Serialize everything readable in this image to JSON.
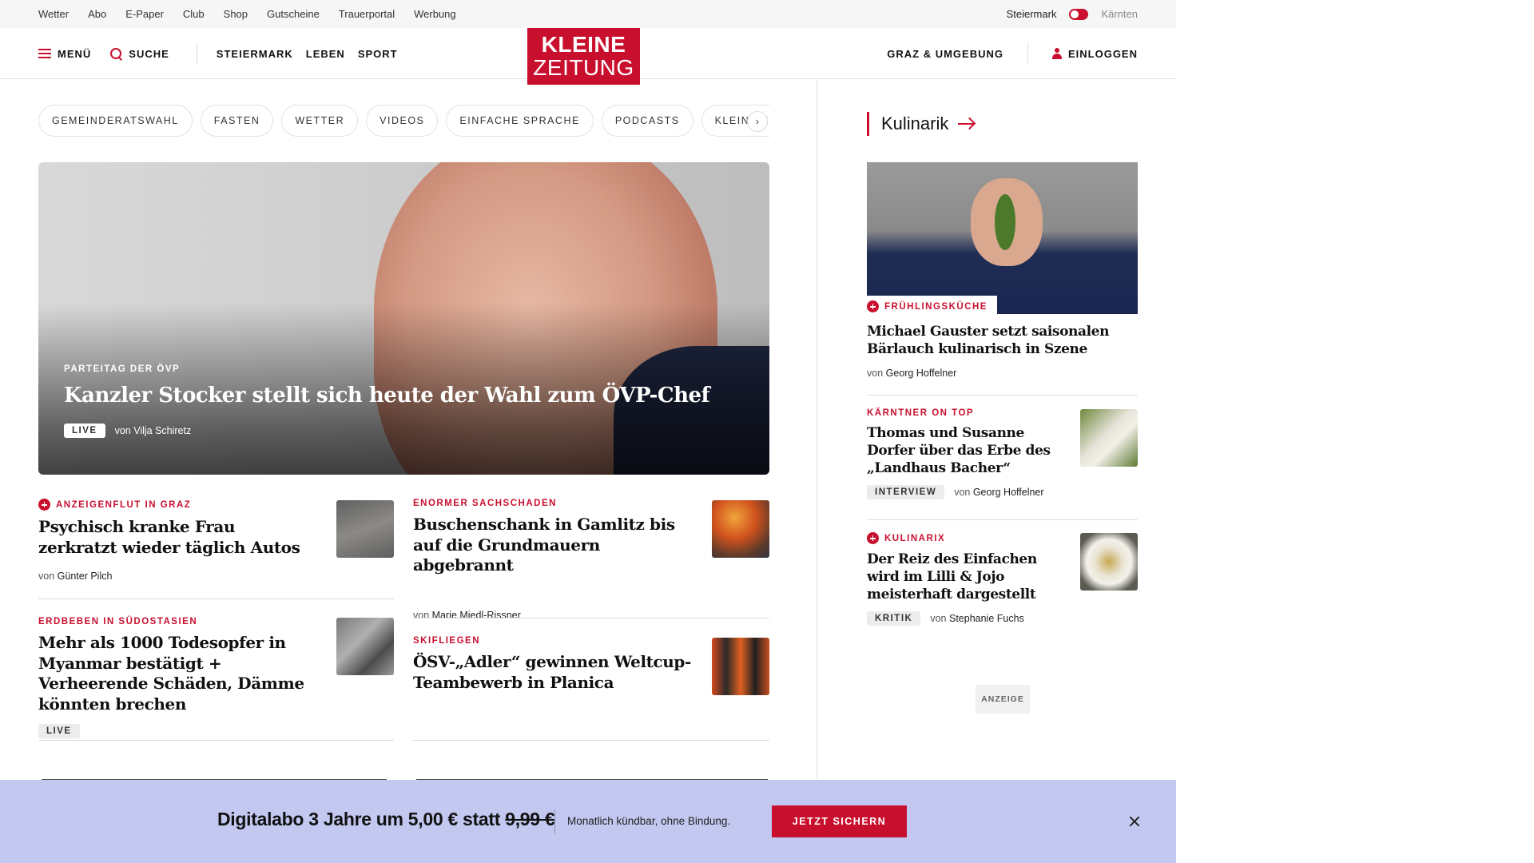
{
  "topbar": {
    "links": [
      "Wetter",
      "Abo",
      "E-Paper",
      "Club",
      "Shop",
      "Gutscheine",
      "Trauerportal",
      "Werbung"
    ],
    "region_active": "Steiermark",
    "region_inactive": "Kärnten"
  },
  "header": {
    "menu_label": "MENÜ",
    "search_label": "SUCHE",
    "nav": [
      "STEIERMARK",
      "LEBEN",
      "SPORT"
    ],
    "logo_line1": "KLEINE",
    "logo_line2": "ZEITUNG",
    "location": "GRAZ & UMGEBUNG",
    "login_label": "EINLOGGEN"
  },
  "pills": [
    "GEMEINDERATSWAHL",
    "FASTEN",
    "WETTER",
    "VIDEOS",
    "EINFACHE SPRACHE",
    "PODCASTS",
    "KLEINE KINDE"
  ],
  "hero": {
    "kicker": "PARTEITAG DER ÖVP",
    "title": "Kanzler Stocker stellt sich heute der Wahl zum ÖVP-Chef",
    "badge": "LIVE",
    "byline_prefix": "von",
    "author": "Vilja Schiretz"
  },
  "articles": [
    {
      "kicker": "ANZEIGENFLUT IN GRAZ",
      "title": "Psychisch kranke Frau zerkratzt wieder täglich Autos",
      "by": "von",
      "author": "Günter Pilch"
    },
    {
      "kicker": "ENORMER SACHSCHADEN",
      "title": "Buschenschank in Gamlitz bis auf die Grundmauern abgebrannt",
      "by": "von",
      "author": "Marie Miedl-Rissner"
    },
    {
      "kicker": "ERDBEBEN IN SÜDOSTASIEN",
      "title": "Mehr als 1000 Todesopfer in Myanmar bestätigt + Verheerende Schäden, Dämme könnten brechen",
      "badge": "LIVE"
    },
    {
      "kicker": "SKIFLIEGEN",
      "title": "ÖSV-„Adler“ gewinnen Weltcup-Teambewerb in Planica"
    }
  ],
  "sidebar": {
    "title": "Kulinarik",
    "items": [
      {
        "kicker": "FRÜHLINGSKÜCHE",
        "title": "Michael Gauster setzt saisonalen Bärlauch kulinarisch in Szene",
        "by": "von",
        "author": "Georg Hoffelner"
      },
      {
        "kicker": "KÄRNTNER ON TOP",
        "title": "Thomas und Susanne Dorfer über das Erbe des „Landhaus Bacher“",
        "badge": "INTERVIEW",
        "by": "von",
        "author": "Georg Hoffelner"
      },
      {
        "kicker": "KULINARIX",
        "title": "Der Reiz des Einfachen wird im Lilli & Jojo meisterhaft dargestellt",
        "badge": "KRITIK",
        "by": "von",
        "author": "Stephanie Fuchs"
      }
    ],
    "ad_label": "ANZEIGE"
  },
  "banner": {
    "title_main": "Digitalabo 3 Jahre um 5,00 € statt",
    "title_old_price": "9,99 €",
    "subtitle": "Monatlich kündbar, ohne Bindung.",
    "cta": "JETZT SICHERN"
  },
  "colors": {
    "brand_red": "#c8102e",
    "banner_bg": "#c2c8f0"
  }
}
